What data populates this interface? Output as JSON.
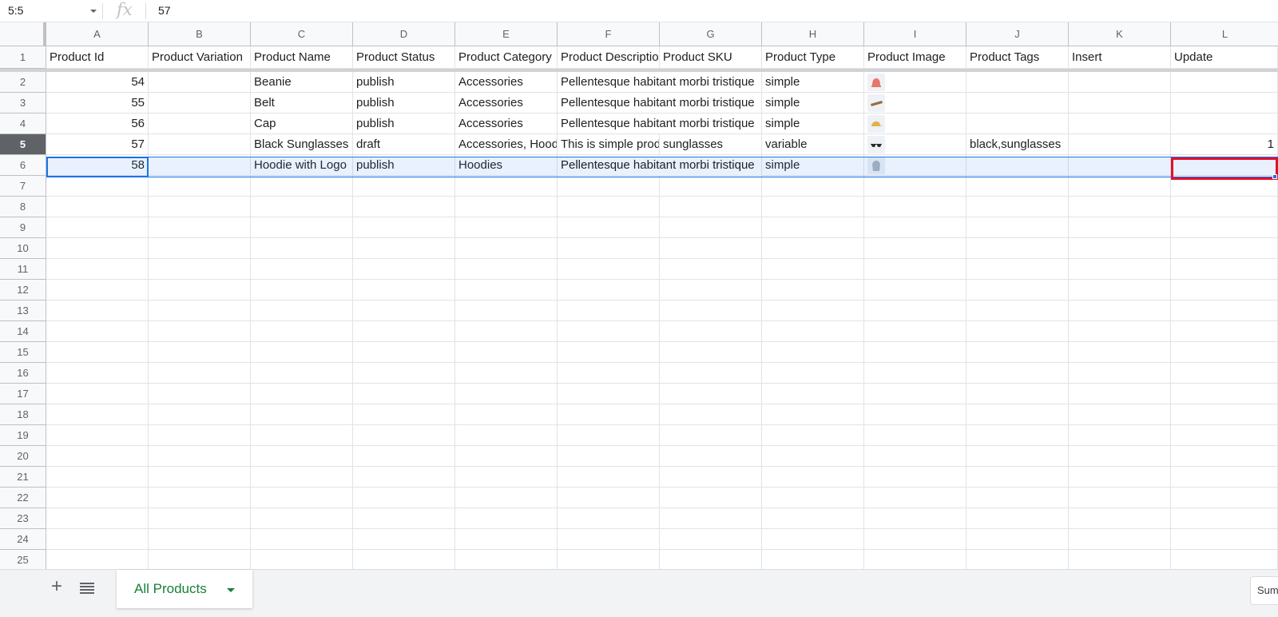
{
  "formula_bar": {
    "name_box": "5:5",
    "fx_symbol": "fx",
    "value": "57"
  },
  "columns": [
    "A",
    "B",
    "C",
    "D",
    "E",
    "F",
    "G",
    "H",
    "I",
    "J",
    "K",
    "L"
  ],
  "row_numbers": [
    "1",
    "2",
    "3",
    "4",
    "5",
    "6",
    "7",
    "8",
    "9",
    "10",
    "11",
    "12",
    "13",
    "14",
    "15",
    "16",
    "17",
    "18",
    "19",
    "20",
    "21",
    "22",
    "23",
    "24",
    "25"
  ],
  "selected_row": "5",
  "rows": [
    [
      "Product Id",
      "Product Variation",
      "Product Name",
      "Product Status",
      "Product Category",
      "Product Description",
      "Product SKU",
      "Product Type",
      "Product Image",
      "Product Tags",
      "Insert",
      "Update"
    ],
    [
      "54",
      "",
      "Beanie",
      "publish",
      "Accessories",
      "Pellentesque habitant morbi tristique",
      "",
      "simple",
      "",
      "",
      "",
      ""
    ],
    [
      "55",
      "",
      "Belt",
      "publish",
      "Accessories",
      "Pellentesque habitant morbi tristique",
      "",
      "simple",
      "",
      "",
      "",
      ""
    ],
    [
      "56",
      "",
      "Cap",
      "publish",
      "Accessories",
      "Pellentesque habitant morbi tristique",
      "",
      "simple",
      "",
      "",
      "",
      ""
    ],
    [
      "57",
      "",
      "Black Sunglasses",
      "draft",
      "Accessories, Hoodies",
      "This is simple product",
      "sunglasses",
      "variable",
      "",
      "black,sunglasses",
      "",
      "1"
    ],
    [
      "58",
      "",
      "Hoodie with Logo",
      "publish",
      "Hoodies",
      "Pellentesque habitant morbi tristique",
      "",
      "simple",
      "",
      "",
      "",
      ""
    ]
  ],
  "product_images": [
    {
      "row": 2,
      "icon": "beanie-icon",
      "color": "#e8756a"
    },
    {
      "row": 3,
      "icon": "belt-icon",
      "color": "#9c6b3e"
    },
    {
      "row": 4,
      "icon": "cap-icon",
      "color": "#e3b04b"
    },
    {
      "row": 5,
      "icon": "sunglasses-icon",
      "color": "#2b2b2b"
    },
    {
      "row": 6,
      "icon": "hoodie-icon",
      "color": "#a9b4bd"
    }
  ],
  "sheet_tabs": {
    "add_label": "+",
    "active_tab": "All Products"
  },
  "status_bar": {
    "sum_label": "Sum"
  },
  "colors": {
    "accent": "#1a73e8",
    "highlight": "#e0112b",
    "tab_text": "#188038"
  }
}
